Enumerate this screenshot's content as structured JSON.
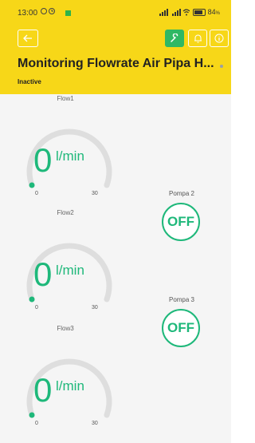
{
  "status_bar": {
    "time": "13:00",
    "battery": "84"
  },
  "header": {
    "title": "Monitoring Flowrate Air Pipa H...",
    "status": "Inactive",
    "accent_color": "#f7d718",
    "wrench_color": "#2fb864"
  },
  "gauges": [
    {
      "label": "Flow1",
      "value": "0",
      "unit": "l/min",
      "min": "0",
      "max": "30",
      "level": 0
    },
    {
      "label": "Flow2",
      "value": "0",
      "unit": "l/min",
      "min": "0",
      "max": "30",
      "level": 0
    },
    {
      "label": "Flow3",
      "value": "0",
      "unit": "l/min",
      "min": "0",
      "max": "30",
      "level": 0
    }
  ],
  "pumps": [
    {
      "label": "Pompa 2",
      "state": "OFF"
    },
    {
      "label": "Pompa 3",
      "state": "OFF"
    }
  ],
  "icons": [
    "back-arrow-icon",
    "wrench-icon",
    "bell-icon",
    "info-icon",
    "alarm-icon",
    "signal-icon",
    "wifi-icon",
    "battery-icon"
  ],
  "value_color": "#1eb87a"
}
